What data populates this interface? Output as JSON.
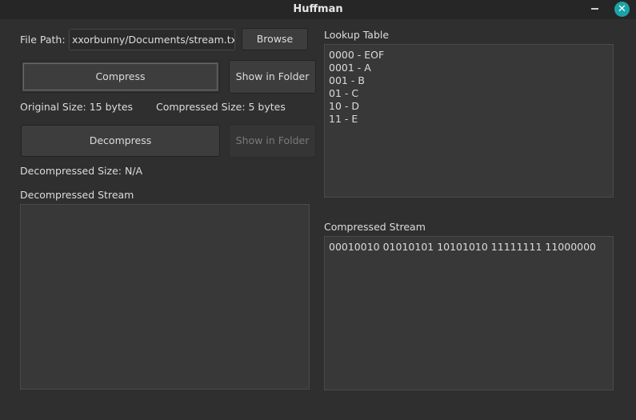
{
  "window": {
    "title": "Huffman"
  },
  "file": {
    "label": "File Path:",
    "value": "xxorbunny/Documents/stream.txt",
    "browse_label": "Browse"
  },
  "compress": {
    "label": "Compress",
    "show_folder_label": "Show in Folder"
  },
  "sizes": {
    "original": "Original Size: 15 bytes",
    "compressed": "Compressed Size: 5 bytes",
    "decompressed": "Decompressed Size: N/A"
  },
  "decompress": {
    "label": "Decompress",
    "show_folder_label": "Show in Folder"
  },
  "decompressed_stream": {
    "label": "Decompressed Stream",
    "content": ""
  },
  "lookup_table": {
    "label": "Lookup Table",
    "lines": [
      "0000 - EOF",
      "0001 - A",
      "001 - B",
      "01 - C",
      "10 - D",
      "11 - E"
    ]
  },
  "compressed_stream": {
    "label": "Compressed Stream",
    "content": "00010010 01010101 10101010 11111111 11000000"
  },
  "colors": {
    "accent": "#1ba3a8",
    "background": "#2f2f2f"
  }
}
